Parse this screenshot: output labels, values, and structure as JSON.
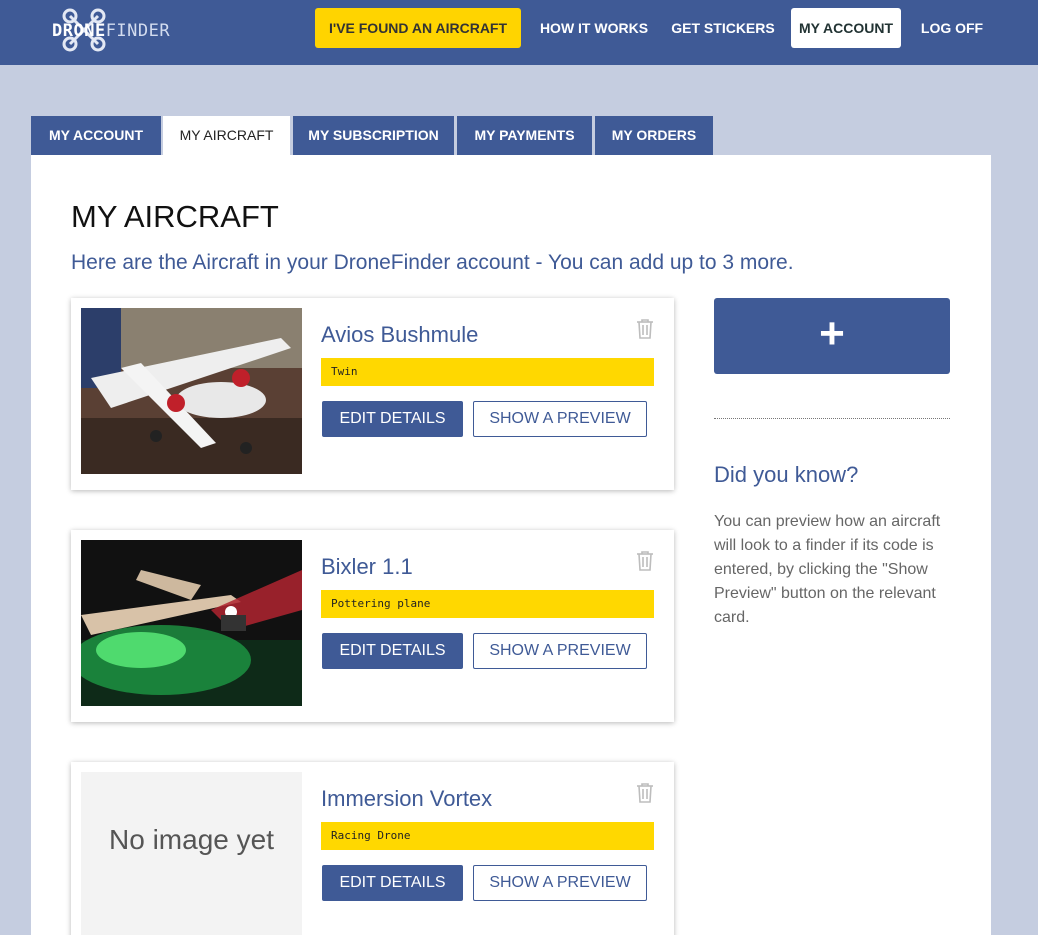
{
  "header": {
    "logo": {
      "part1": "DRONE",
      "part2": "FINDER"
    },
    "nav": {
      "found": "I'VE FOUND AN AIRCRAFT",
      "how": "HOW IT WORKS",
      "stickers": "GET STICKERS",
      "account": "MY ACCOUNT",
      "logoff": "LOG OFF"
    }
  },
  "tabs": [
    "MY ACCOUNT",
    "MY AIRCRAFT",
    "MY SUBSCRIPTION",
    "MY PAYMENTS",
    "MY ORDERS"
  ],
  "main": {
    "title": "MY AIRCRAFT",
    "subtitle": "Here are the Aircraft in your DroneFinder account - You can add up to 3 more."
  },
  "aircraft": [
    {
      "name": "Avios Bushmule",
      "tag": "Twin",
      "image": "photo"
    },
    {
      "name": "Bixler 1.1",
      "tag": "Pottering plane",
      "image": "photo"
    },
    {
      "name": "Immersion Vortex",
      "tag": "Racing Drone",
      "image": "none",
      "no_image_text": "No image yet"
    }
  ],
  "buttons": {
    "edit": "EDIT DETAILS",
    "preview": "SHOW A PREVIEW",
    "add": "+"
  },
  "sidebar": {
    "title": "Did you know?",
    "body": "You can preview how an aircraft will look to a finder if its code is entered, by clicking the \"Show Preview\" button on the relevant card."
  },
  "colors": {
    "brand": "#3f5a96",
    "accent": "#ffd400",
    "background": "#c5cde0"
  },
  "icons": {
    "trash": "trash-icon",
    "logo": "drone-logo-icon"
  }
}
